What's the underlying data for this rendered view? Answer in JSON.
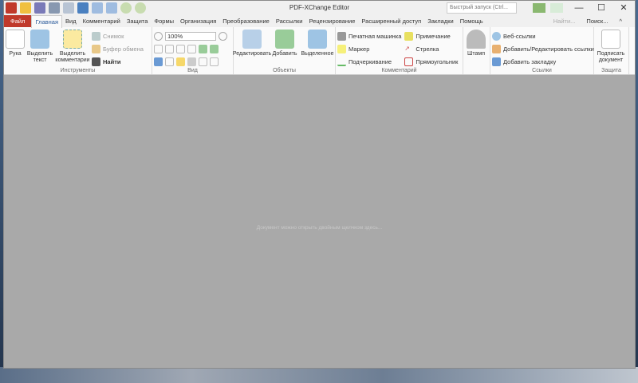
{
  "window": {
    "title": "PDF-XChange Editor",
    "search_placeholder": "Быстрый запуск (Ctrl...",
    "minimize": "—",
    "maximize": "☐",
    "close": "✕"
  },
  "menu": {
    "tabs": [
      "Файл",
      "Главная",
      "Вид",
      "Комментарий",
      "Защита",
      "Формы",
      "Организация",
      "Преобразование",
      "Рассылки",
      "Рецензирование",
      "Расширенный доступ",
      "Закладки",
      "Помощь"
    ],
    "find": "Найти...",
    "search": "Поиск...",
    "collapse": "^"
  },
  "ribbon": {
    "tools": {
      "label": "Инструменты",
      "hand": "Рука",
      "select_text": "Выделить текст",
      "select_comments": "Выделить комментарии",
      "snapshot": "Снимок",
      "clipboard": "Буфер обмена",
      "find": "Найти"
    },
    "view": {
      "label": "Вид",
      "zoom": "100%"
    },
    "objects": {
      "label": "Объекты",
      "edit": "Редактировать",
      "add": "Добавить",
      "selected": "Выделенное"
    },
    "comments": {
      "label": "Комментарий",
      "typewriter": "Печатная машинка",
      "note": "Примечание",
      "marker": "Маркер",
      "arrow": "Стрелка",
      "underline": "Подчеркивание",
      "rectangle": "Прямоугольник",
      "stamp": "Штамп"
    },
    "links": {
      "label": "Ссылки",
      "web": "Веб-ссылки",
      "add_edit": "Добавить/Редактировать ссылки",
      "bookmark": "Добавить закладку"
    },
    "protect": {
      "label": "Защита",
      "sign": "Подписать документ"
    }
  },
  "main": {
    "hint": "Документ можно открыть двойным щелчком здесь..."
  }
}
